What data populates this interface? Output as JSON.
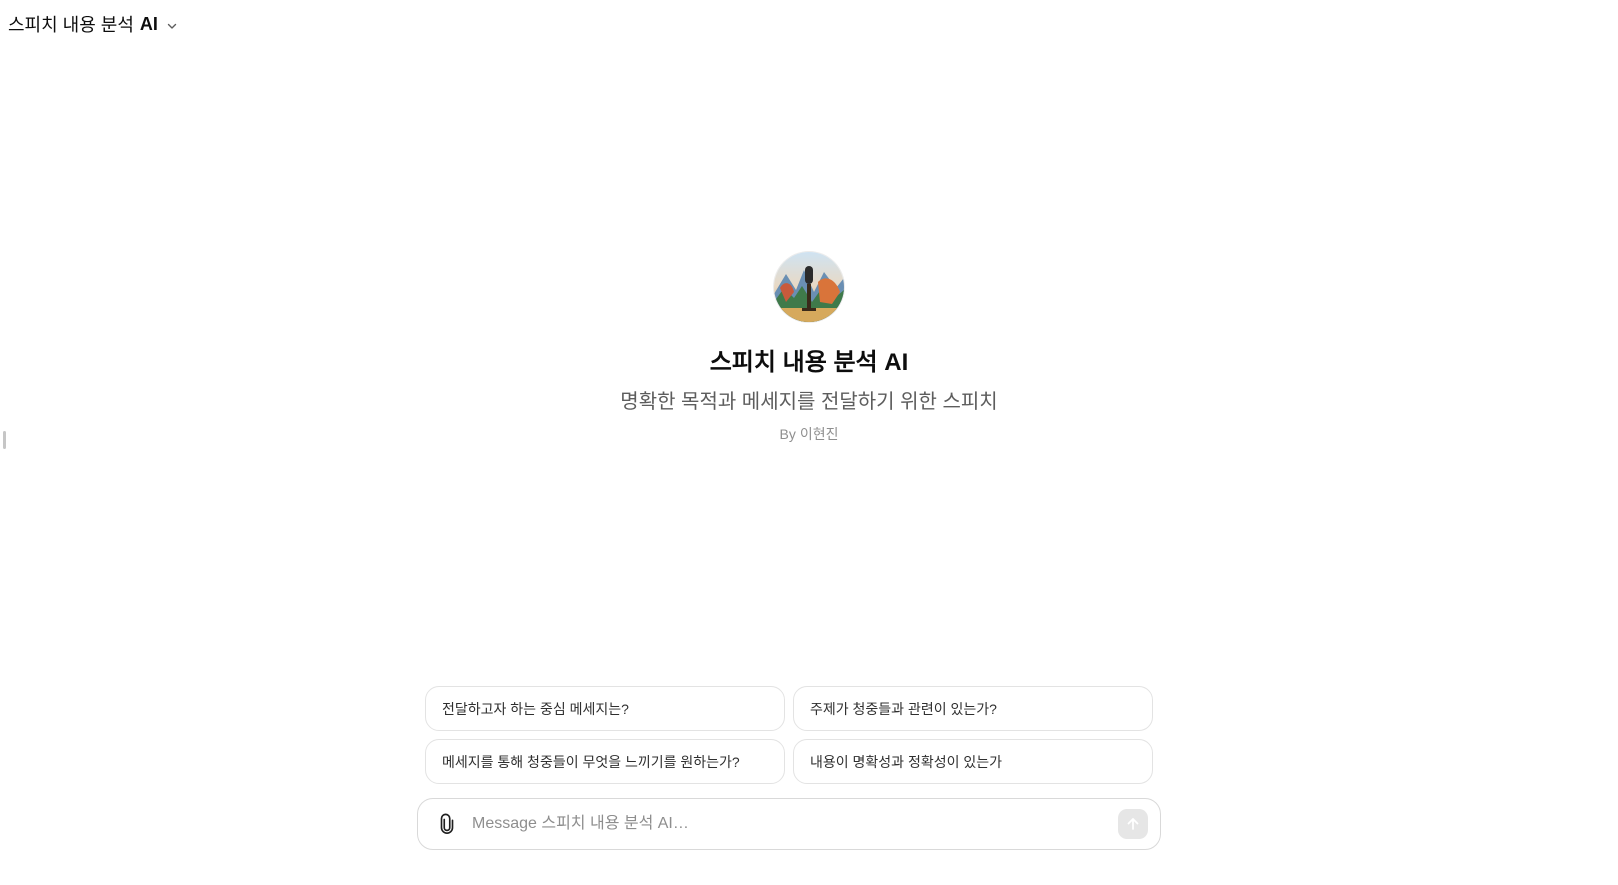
{
  "header": {
    "gpt_name_prefix": "스피치 내용 분석",
    "gpt_name_suffix": "AI",
    "dropdown_icon": "chevron-down-icon"
  },
  "hero": {
    "title": "스피치 내용 분석 AI",
    "description": "명확한 목적과 메세지를 전달하기 위한 스피치",
    "by_label": "By",
    "author": "이현진",
    "avatar_icon": "microphone-landscape-avatar"
  },
  "prompts": [
    {
      "label": "전달하고자 하는 중심 메세지는?"
    },
    {
      "label": "주제가 청중들과 관련이 있는가?"
    },
    {
      "label": "메세지를 통해 청중들이 무엇을 느끼기를 원하는가?"
    },
    {
      "label": "내용이 명확성과 정확성이 있는가"
    }
  ],
  "composer": {
    "placeholder": "Message 스피치 내용 분석 AI…",
    "value": "",
    "attach_icon": "paperclip-icon",
    "send_icon": "arrow-up-icon"
  },
  "colors": {
    "text": "#0d0d0d",
    "muted": "#5d5d5d",
    "border": "#e3e3e3",
    "send_disabled": "#e6e6e6"
  }
}
